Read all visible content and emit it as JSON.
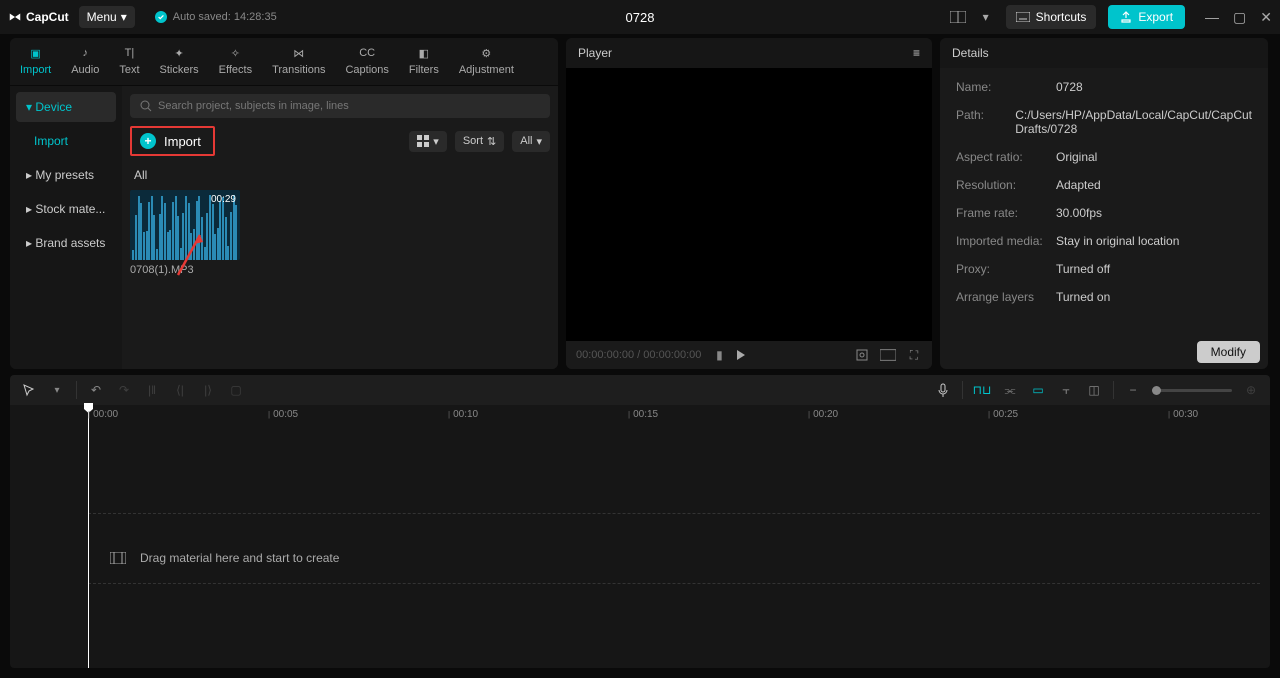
{
  "titlebar": {
    "logo_text": "CapCut",
    "menu_label": "Menu",
    "autosave_text": "Auto saved: 14:28:35",
    "project_title": "0728",
    "shortcuts_label": "Shortcuts",
    "export_label": "Export"
  },
  "tabs": [
    "Import",
    "Audio",
    "Text",
    "Stickers",
    "Effects",
    "Transitions",
    "Captions",
    "Filters",
    "Adjustment"
  ],
  "sidebar": {
    "items": [
      {
        "label": "Device",
        "expanded": true,
        "active": true
      },
      {
        "label": "Import",
        "sub": true
      },
      {
        "label": "My presets"
      },
      {
        "label": "Stock mate..."
      },
      {
        "label": "Brand assets"
      }
    ]
  },
  "media": {
    "search_placeholder": "Search project, subjects in image, lines",
    "import_label": "Import",
    "sort_label": "Sort",
    "all_filter": "All",
    "section_label": "All",
    "clip": {
      "duration": "00:29",
      "name": "0708(1).MP3"
    }
  },
  "player": {
    "title": "Player",
    "timecode": "00:00:00:00 / 00:00:00:00"
  },
  "details": {
    "title": "Details",
    "rows": [
      {
        "label": "Name:",
        "value": "0728"
      },
      {
        "label": "Path:",
        "value": "C:/Users/HP/AppData/Local/CapCut/CapCut Drafts/0728"
      },
      {
        "label": "Aspect ratio:",
        "value": "Original"
      },
      {
        "label": "Resolution:",
        "value": "Adapted"
      },
      {
        "label": "Frame rate:",
        "value": "30.00fps"
      },
      {
        "label": "Imported media:",
        "value": "Stay in original location"
      },
      {
        "label": "Proxy:",
        "value": "Turned off"
      },
      {
        "label": "Arrange layers",
        "value": "Turned on"
      }
    ],
    "modify_label": "Modify"
  },
  "timeline": {
    "marks": [
      "00:00",
      "00:05",
      "00:10",
      "00:15",
      "00:20",
      "00:25",
      "00:30"
    ],
    "hint": "Drag material here and start to create"
  }
}
